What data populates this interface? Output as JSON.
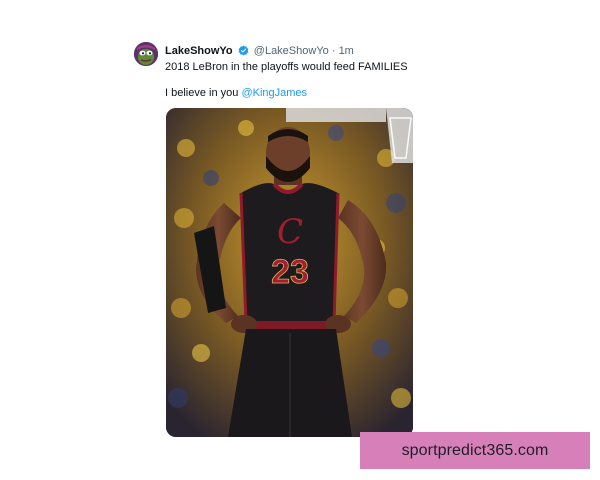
{
  "tweet": {
    "display_name": "LakeShowYo",
    "handle": "@LakeShowYo",
    "separator": "·",
    "time": "1m",
    "verified": true,
    "line1": "2018 LeBron in the playoffs would feed FAMILIES",
    "line2_prefix": "I believe in you ",
    "mention": "@KingJames",
    "media": {
      "alt": "",
      "jersey_number": "23"
    }
  },
  "watermark": {
    "text": "sportpredict365.com"
  },
  "colors": {
    "text": "#0f1419",
    "secondary": "#536471",
    "link": "#1d9bf0",
    "verified": "#1d9bf0",
    "watermark_bg": "#d77fb8"
  },
  "icons": {
    "verified": "verified-badge-icon",
    "avatar": "pepe-avatar-icon"
  }
}
